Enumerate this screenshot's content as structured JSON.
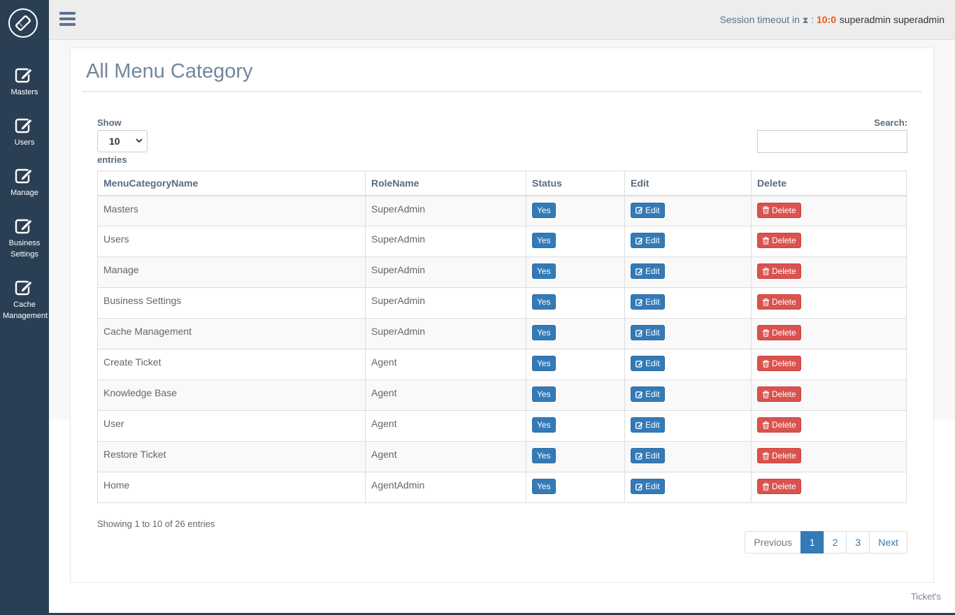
{
  "topbar": {
    "session_label": "Session timeout in",
    "session_sep": ":",
    "session_time": "10:0",
    "username": "superadmin superadmin"
  },
  "sidebar": {
    "items": [
      {
        "label": "Masters",
        "icon": "edit-icon"
      },
      {
        "label": "Users",
        "icon": "edit-icon"
      },
      {
        "label": "Manage",
        "icon": "edit-icon"
      },
      {
        "label": "Business Settings",
        "icon": "edit-icon"
      },
      {
        "label": "Cache Management",
        "icon": "edit-icon"
      }
    ]
  },
  "page": {
    "title": "All Menu Category",
    "show_label": "Show",
    "page_length": "10",
    "entries_label": "entries",
    "search_label": "Search:",
    "search_value": ""
  },
  "table": {
    "columns": [
      "MenuCategoryName",
      "RoleName",
      "Status",
      "Edit",
      "Delete"
    ],
    "rows": [
      {
        "name": "Masters",
        "role": "SuperAdmin",
        "status": "Yes",
        "edit": "Edit",
        "delete": "Delete"
      },
      {
        "name": "Users",
        "role": "SuperAdmin",
        "status": "Yes",
        "edit": "Edit",
        "delete": "Delete"
      },
      {
        "name": "Manage",
        "role": "SuperAdmin",
        "status": "Yes",
        "edit": "Edit",
        "delete": "Delete"
      },
      {
        "name": "Business Settings",
        "role": "SuperAdmin",
        "status": "Yes",
        "edit": "Edit",
        "delete": "Delete"
      },
      {
        "name": "Cache Management",
        "role": "SuperAdmin",
        "status": "Yes",
        "edit": "Edit",
        "delete": "Delete"
      },
      {
        "name": "Create Ticket",
        "role": "Agent",
        "status": "Yes",
        "edit": "Edit",
        "delete": "Delete"
      },
      {
        "name": "Knowledge Base",
        "role": "Agent",
        "status": "Yes",
        "edit": "Edit",
        "delete": "Delete"
      },
      {
        "name": "User",
        "role": "Agent",
        "status": "Yes",
        "edit": "Edit",
        "delete": "Delete"
      },
      {
        "name": "Restore Ticket",
        "role": "Agent",
        "status": "Yes",
        "edit": "Edit",
        "delete": "Delete"
      },
      {
        "name": "Home",
        "role": "AgentAdmin",
        "status": "Yes",
        "edit": "Edit",
        "delete": "Delete"
      }
    ]
  },
  "info": "Showing 1 to 10 of 26 entries",
  "pagination": {
    "previous": "Previous",
    "pages": [
      "1",
      "2",
      "3"
    ],
    "active": "1",
    "next": "Next"
  },
  "footer": "Ticket's",
  "colors": {
    "sidebar": "#2a3f54",
    "primary": "#337ab7",
    "danger": "#d9534f",
    "timer": "#f2581e"
  }
}
